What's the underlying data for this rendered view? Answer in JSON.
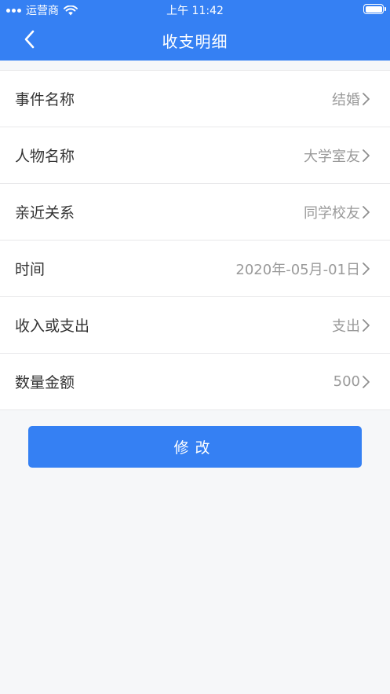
{
  "status_bar": {
    "carrier": "运营商",
    "time": "上午 11:42"
  },
  "nav": {
    "title": "收支明细",
    "back_icon": "chevron-left-icon"
  },
  "rows": [
    {
      "label": "事件名称",
      "value": "结婚"
    },
    {
      "label": "人物名称",
      "value": "大学室友"
    },
    {
      "label": "亲近关系",
      "value": "同学校友"
    },
    {
      "label": "时间",
      "value": "2020年-05月-01日"
    },
    {
      "label": "收入或支出",
      "value": "支出"
    },
    {
      "label": "数量金额",
      "value": "500"
    }
  ],
  "submit_label": "修改",
  "colors": {
    "primary": "#3580f3",
    "background": "#f6f7f9",
    "label_text": "#333333",
    "value_text": "#9a9a9a"
  }
}
